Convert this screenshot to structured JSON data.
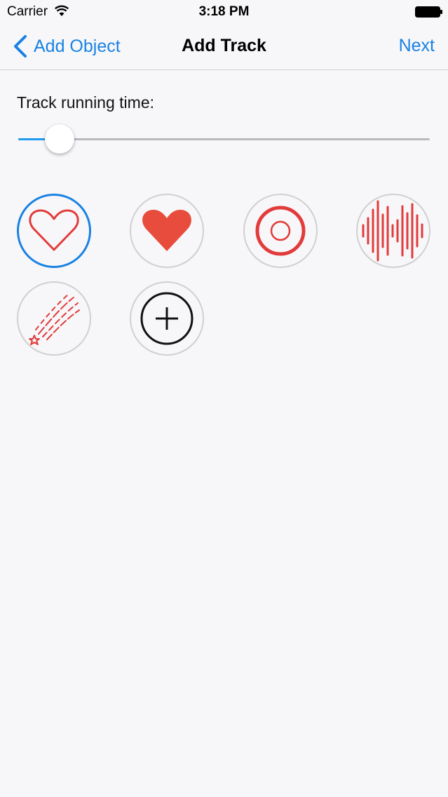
{
  "status_bar": {
    "carrier": "Carrier",
    "time": "3:18 PM"
  },
  "nav": {
    "back_label": "Add Object",
    "title": "Add Track",
    "next_label": "Next"
  },
  "settings": {
    "running_time_label": "Track running time:",
    "slider_value": 0.1
  },
  "icons": [
    {
      "name": "heart-outline-icon",
      "selected": true
    },
    {
      "name": "heart-filled-icon",
      "selected": false
    },
    {
      "name": "target-circle-icon",
      "selected": false
    },
    {
      "name": "sound-wave-icon",
      "selected": false
    },
    {
      "name": "shooting-star-icon",
      "selected": false
    },
    {
      "name": "add-icon",
      "selected": false
    }
  ],
  "colors": {
    "accent": "#1a82e2",
    "icon_red": "#e23b3b",
    "slider_fill": "#1f9bf0"
  }
}
